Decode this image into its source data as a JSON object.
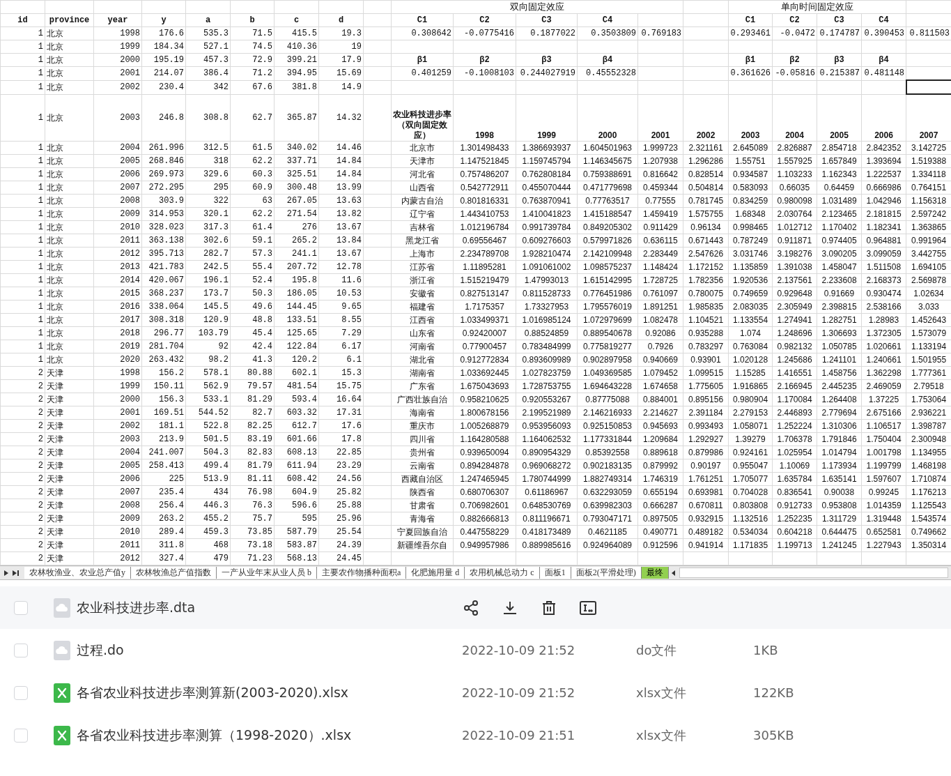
{
  "sheet": {
    "data_table": {
      "columns": [
        "id",
        "province",
        "year",
        "y",
        "a",
        "b",
        "c",
        "d"
      ],
      "rows": [
        [
          "1",
          "北京",
          "1998",
          "176.6",
          "535.3",
          "71.5",
          "415.5",
          "19.3"
        ],
        [
          "1",
          "北京",
          "1999",
          "184.34",
          "527.1",
          "74.5",
          "410.36",
          "19"
        ],
        [
          "1",
          "北京",
          "2000",
          "195.19",
          "457.3",
          "72.9",
          "399.21",
          "17.9"
        ],
        [
          "1",
          "北京",
          "2001",
          "214.07",
          "386.4",
          "71.2",
          "394.95",
          "15.69"
        ],
        [
          "1",
          "北京",
          "2002",
          "230.4",
          "342",
          "67.6",
          "381.8",
          "14.9"
        ],
        [
          "1",
          "北京",
          "2003",
          "246.8",
          "308.8",
          "62.7",
          "365.87",
          "14.32"
        ],
        [
          "1",
          "北京",
          "2004",
          "261.996",
          "312.5",
          "61.5",
          "340.02",
          "14.46"
        ],
        [
          "1",
          "北京",
          "2005",
          "268.846",
          "318",
          "62.2",
          "337.71",
          "14.84"
        ],
        [
          "1",
          "北京",
          "2006",
          "269.973",
          "329.6",
          "60.3",
          "325.51",
          "14.84"
        ],
        [
          "1",
          "北京",
          "2007",
          "272.295",
          "295",
          "60.9",
          "300.48",
          "13.99"
        ],
        [
          "1",
          "北京",
          "2008",
          "303.9",
          "322",
          "63",
          "267.05",
          "13.63"
        ],
        [
          "1",
          "北京",
          "2009",
          "314.953",
          "320.1",
          "62.2",
          "271.54",
          "13.82"
        ],
        [
          "1",
          "北京",
          "2010",
          "328.023",
          "317.3",
          "61.4",
          "276",
          "13.67"
        ],
        [
          "1",
          "北京",
          "2011",
          "363.138",
          "302.6",
          "59.1",
          "265.2",
          "13.84"
        ],
        [
          "1",
          "北京",
          "2012",
          "395.713",
          "282.7",
          "57.3",
          "241.1",
          "13.67"
        ],
        [
          "1",
          "北京",
          "2013",
          "421.783",
          "242.5",
          "55.4",
          "207.72",
          "12.78"
        ],
        [
          "1",
          "北京",
          "2014",
          "420.067",
          "196.1",
          "52.4",
          "195.8",
          "11.6"
        ],
        [
          "1",
          "北京",
          "2015",
          "368.237",
          "173.7",
          "50.3",
          "186.05",
          "10.53"
        ],
        [
          "1",
          "北京",
          "2016",
          "338.064",
          "145.5",
          "49.6",
          "144.45",
          "9.65"
        ],
        [
          "1",
          "北京",
          "2017",
          "308.318",
          "120.9",
          "48.8",
          "133.51",
          "8.55"
        ],
        [
          "1",
          "北京",
          "2018",
          "296.77",
          "103.79",
          "45.4",
          "125.65",
          "7.29"
        ],
        [
          "1",
          "北京",
          "2019",
          "281.704",
          "92",
          "42.4",
          "122.84",
          "6.17"
        ],
        [
          "1",
          "北京",
          "2020",
          "263.432",
          "98.2",
          "41.3",
          "120.2",
          "6.1"
        ],
        [
          "2",
          "天津",
          "1998",
          "156.2",
          "578.1",
          "80.88",
          "602.1",
          "15.3"
        ],
        [
          "2",
          "天津",
          "1999",
          "150.11",
          "562.9",
          "79.57",
          "481.54",
          "15.75"
        ],
        [
          "2",
          "天津",
          "2000",
          "156.3",
          "533.1",
          "81.29",
          "593.4",
          "16.64"
        ],
        [
          "2",
          "天津",
          "2001",
          "169.51",
          "544.52",
          "82.7",
          "603.32",
          "17.31"
        ],
        [
          "2",
          "天津",
          "2002",
          "181.1",
          "522.8",
          "82.25",
          "612.7",
          "17.6"
        ],
        [
          "2",
          "天津",
          "2003",
          "213.9",
          "501.5",
          "83.19",
          "601.66",
          "17.8"
        ],
        [
          "2",
          "天津",
          "2004",
          "241.007",
          "504.3",
          "82.83",
          "608.13",
          "22.85"
        ],
        [
          "2",
          "天津",
          "2005",
          "258.413",
          "499.4",
          "81.79",
          "611.94",
          "23.29"
        ],
        [
          "2",
          "天津",
          "2006",
          "225",
          "513.9",
          "81.11",
          "608.42",
          "24.56"
        ],
        [
          "2",
          "天津",
          "2007",
          "235.4",
          "434",
          "76.98",
          "604.9",
          "25.82"
        ],
        [
          "2",
          "天津",
          "2008",
          "256.4",
          "446.3",
          "76.3",
          "596.6",
          "25.88"
        ],
        [
          "2",
          "天津",
          "2009",
          "263.2",
          "455.2",
          "75.7",
          "595",
          "25.96"
        ],
        [
          "2",
          "天津",
          "2010",
          "289.4",
          "459.3",
          "73.85",
          "587.79",
          "25.54"
        ],
        [
          "2",
          "天津",
          "2011",
          "311.8",
          "468",
          "73.18",
          "583.87",
          "24.39"
        ],
        [
          "2",
          "天津",
          "2012",
          "327.4",
          "479",
          "71.23",
          "568.13",
          "24.45"
        ]
      ]
    },
    "two_way_fixed_effects": {
      "title": "双向固定效应",
      "coef_headers": [
        "C1",
        "C2",
        "C3",
        "C4"
      ],
      "coef_values": [
        "0.308642",
        "-0.0775416",
        "0.1877022",
        "0.3503809",
        "0.769183"
      ],
      "beta_headers": [
        "β1",
        "β2",
        "β3",
        "β4"
      ],
      "beta_values": [
        "0.401259",
        "-0.1008103",
        "0.244027919",
        "0.45552328"
      ]
    },
    "one_way_time_fixed_effects": {
      "title": "单向时间固定效应",
      "coef_headers": [
        "C1",
        "C2",
        "C3",
        "C4"
      ],
      "coef_values": [
        "0.293461",
        "-0.0472",
        "0.174787",
        "0.390453",
        "0.811503"
      ],
      "beta_headers": [
        "β1",
        "β2",
        "β3",
        "β4"
      ],
      "beta_values": [
        "0.361626",
        "-0.05816",
        "0.215387",
        "0.481148"
      ],
      "blank_cells": [
        {
          "selected": false
        },
        {
          "selected": false
        },
        {
          "selected": false
        },
        {
          "selected": false
        },
        {
          "selected": true
        }
      ]
    },
    "rate_table": {
      "corner": "农业科技进步率（双向固定效应）",
      "years": [
        "1998",
        "1999",
        "2000",
        "2001",
        "2002",
        "2003",
        "2004",
        "2005",
        "2006",
        "2007"
      ],
      "rows": [
        {
          "province": "北京市",
          "values": [
            "1.301498433",
            "1.386693937",
            "1.604501963",
            "1.999723",
            "2.321161",
            "2.645089",
            "2.826887",
            "2.854718",
            "2.842352",
            "3.142725"
          ]
        },
        {
          "province": "天津市",
          "values": [
            "1.147521845",
            "1.159745794",
            "1.146345675",
            "1.207938",
            "1.296286",
            "1.55751",
            "1.557925",
            "1.657849",
            "1.393694",
            "1.519388"
          ]
        },
        {
          "province": "河北省",
          "values": [
            "0.757486207",
            "0.762808184",
            "0.759388691",
            "0.816642",
            "0.828514",
            "0.934587",
            "1.103233",
            "1.162343",
            "1.222537",
            "1.334118"
          ]
        },
        {
          "province": "山西省",
          "values": [
            "0.542772911",
            "0.455070444",
            "0.471779698",
            "0.459344",
            "0.504814",
            "0.583093",
            "0.66035",
            "0.64459",
            "0.666986",
            "0.764151"
          ]
        },
        {
          "province": "内蒙古自治",
          "values": [
            "0.801816331",
            "0.763870941",
            "0.77763517",
            "0.77555",
            "0.781745",
            "0.834259",
            "0.980098",
            "1.031489",
            "1.042946",
            "1.156318"
          ]
        },
        {
          "province": "辽宁省",
          "values": [
            "1.443410753",
            "1.410041823",
            "1.415188547",
            "1.459419",
            "1.575755",
            "1.68348",
            "2.030764",
            "2.123465",
            "2.181815",
            "2.597242"
          ]
        },
        {
          "province": "吉林省",
          "values": [
            "1.012196784",
            "0.991739784",
            "0.849205302",
            "0.911429",
            "0.96134",
            "0.998465",
            "1.012712",
            "1.170402",
            "1.182341",
            "1.363865"
          ]
        },
        {
          "province": "黑龙江省",
          "values": [
            "0.69556467",
            "0.609276603",
            "0.579971826",
            "0.636115",
            "0.671443",
            "0.787249",
            "0.911871",
            "0.974405",
            "0.964881",
            "0.991964"
          ]
        },
        {
          "province": "上海市",
          "values": [
            "2.234789708",
            "1.928210474",
            "2.142109948",
            "2.283449",
            "2.547626",
            "3.031746",
            "3.198276",
            "3.090205",
            "3.099059",
            "3.442755"
          ]
        },
        {
          "province": "江苏省",
          "values": [
            "1.11895281",
            "1.091061002",
            "1.098575237",
            "1.148424",
            "1.172152",
            "1.135859",
            "1.391038",
            "1.458047",
            "1.511508",
            "1.694105"
          ]
        },
        {
          "province": "浙江省",
          "values": [
            "1.515219479",
            "1.47993013",
            "1.615142995",
            "1.728725",
            "1.782356",
            "1.920536",
            "2.137561",
            "2.233608",
            "2.168373",
            "2.569878"
          ]
        },
        {
          "province": "安徽省",
          "values": [
            "0.827513147",
            "0.811528733",
            "0.776451986",
            "0.761097",
            "0.780075",
            "0.749659",
            "0.929648",
            "0.91669",
            "0.930474",
            "1.02634"
          ]
        },
        {
          "province": "福建省",
          "values": [
            "1.7175357",
            "1.73327953",
            "1.795576019",
            "1.891251",
            "1.985835",
            "2.083035",
            "2.305949",
            "2.398815",
            "2.538166",
            "3.033"
          ]
        },
        {
          "province": "江西省",
          "values": [
            "1.033499371",
            "1.016985124",
            "1.072979699",
            "1.082478",
            "1.104521",
            "1.133554",
            "1.274941",
            "1.282751",
            "1.28983",
            "1.452643"
          ]
        },
        {
          "province": "山东省",
          "values": [
            "0.92420007",
            "0.88524859",
            "0.889540678",
            "0.92086",
            "0.935288",
            "1.074",
            "1.248696",
            "1.306693",
            "1.372305",
            "1.573079"
          ]
        },
        {
          "province": "河南省",
          "values": [
            "0.77900457",
            "0.783484999",
            "0.775819277",
            "0.7926",
            "0.783297",
            "0.763084",
            "0.982132",
            "1.050785",
            "1.020661",
            "1.133194"
          ]
        },
        {
          "province": "湖北省",
          "values": [
            "0.912772834",
            "0.893609989",
            "0.902897958",
            "0.940669",
            "0.93901",
            "1.020128",
            "1.245686",
            "1.241101",
            "1.240661",
            "1.501955"
          ]
        },
        {
          "province": "湖南省",
          "values": [
            "1.033692445",
            "1.027823759",
            "1.049369585",
            "1.079452",
            "1.099515",
            "1.15285",
            "1.416551",
            "1.458756",
            "1.362298",
            "1.777361"
          ]
        },
        {
          "province": "广东省",
          "values": [
            "1.675043693",
            "1.728753755",
            "1.694643228",
            "1.674658",
            "1.775605",
            "1.916865",
            "2.166945",
            "2.445235",
            "2.469059",
            "2.79518"
          ]
        },
        {
          "province": "广西壮族自治",
          "values": [
            "0.958210625",
            "0.920553267",
            "0.87775088",
            "0.884001",
            "0.895156",
            "0.980904",
            "1.170084",
            "1.264408",
            "1.37225",
            "1.753064"
          ]
        },
        {
          "province": "海南省",
          "values": [
            "1.800678156",
            "2.199521989",
            "2.146216933",
            "2.214627",
            "2.391184",
            "2.279153",
            "2.446893",
            "2.779694",
            "2.675166",
            "2.936221"
          ]
        },
        {
          "province": "重庆市",
          "values": [
            "1.005268879",
            "0.953956093",
            "0.925150853",
            "0.945693",
            "0.993493",
            "1.058071",
            "1.252224",
            "1.310306",
            "1.106517",
            "1.398787"
          ]
        },
        {
          "province": "四川省",
          "values": [
            "1.164280588",
            "1.164062532",
            "1.177331844",
            "1.209684",
            "1.292927",
            "1.39279",
            "1.706378",
            "1.791846",
            "1.750404",
            "2.300948"
          ]
        },
        {
          "province": "贵州省",
          "values": [
            "0.939650094",
            "0.890954329",
            "0.85392558",
            "0.889618",
            "0.879986",
            "0.924161",
            "1.025954",
            "1.014794",
            "1.001798",
            "1.134955"
          ]
        },
        {
          "province": "云南省",
          "values": [
            "0.894284878",
            "0.969068272",
            "0.902183135",
            "0.879992",
            "0.90197",
            "0.955047",
            "1.10069",
            "1.173934",
            "1.199799",
            "1.468198"
          ]
        },
        {
          "province": "西藏自治区",
          "values": [
            "1.247465945",
            "1.780744999",
            "1.882749314",
            "1.746319",
            "1.761251",
            "1.705077",
            "1.635784",
            "1.635141",
            "1.597607",
            "1.710874"
          ]
        },
        {
          "province": "陕西省",
          "values": [
            "0.680706307",
            "0.61186967",
            "0.632293059",
            "0.655194",
            "0.693981",
            "0.704028",
            "0.836541",
            "0.90038",
            "0.99245",
            "1.176213"
          ]
        },
        {
          "province": "甘肃省",
          "values": [
            "0.706982601",
            "0.648530769",
            "0.639982303",
            "0.666287",
            "0.670811",
            "0.803808",
            "0.912733",
            "0.953808",
            "1.014359",
            "1.125543"
          ]
        },
        {
          "province": "青海省",
          "values": [
            "0.882666813",
            "0.811196671",
            "0.793047171",
            "0.897505",
            "0.932915",
            "1.132516",
            "1.252235",
            "1.311729",
            "1.319448",
            "1.543574"
          ]
        },
        {
          "province": "宁夏回族自治",
          "values": [
            "0.447558229",
            "0.418173489",
            "0.4621185",
            "0.490771",
            "0.489182",
            "0.534034",
            "0.604218",
            "0.644475",
            "0.652581",
            "0.749662"
          ]
        },
        {
          "province": "新疆维吾尔自",
          "values": [
            "0.949957986",
            "0.889985616",
            "0.924964089",
            "0.912596",
            "0.941914",
            "1.171835",
            "1.199713",
            "1.241245",
            "1.227943",
            "1.350314"
          ]
        }
      ]
    },
    "sheet_tabs": [
      {
        "label": "农林牧渔业、农业总产值y",
        "selected": false
      },
      {
        "label": "农林牧渔总产值指数",
        "selected": false
      },
      {
        "label": "一产从业年末从业人员 b",
        "selected": false
      },
      {
        "label": "主要农作物播种面积a",
        "selected": false
      },
      {
        "label": "化肥施用量 d",
        "selected": false
      },
      {
        "label": "农用机械总动力 c",
        "selected": false
      },
      {
        "label": "面板1",
        "selected": false
      },
      {
        "label": "面板2(平滑处理)",
        "selected": false
      },
      {
        "label": "最终",
        "selected": true
      }
    ]
  },
  "files": [
    {
      "name": "农业科技进步率.dta",
      "kind": "generic",
      "hovered": true
    },
    {
      "name": "过程.do",
      "kind": "generic",
      "hovered": false,
      "modified": "2022-10-09 21:52",
      "type": "do文件",
      "size": "1KB"
    },
    {
      "name": "各省农业科技进步率测算新(2003-2020).xlsx",
      "kind": "spreadsheet",
      "hovered": false,
      "modified": "2022-10-09 21:52",
      "type": "xlsx文件",
      "size": "122KB"
    },
    {
      "name": "各省农业科技进步率测算（1998-2020）.xlsx",
      "kind": "spreadsheet",
      "hovered": false,
      "modified": "2022-10-09 21:51",
      "type": "xlsx文件",
      "size": "305KB"
    }
  ]
}
